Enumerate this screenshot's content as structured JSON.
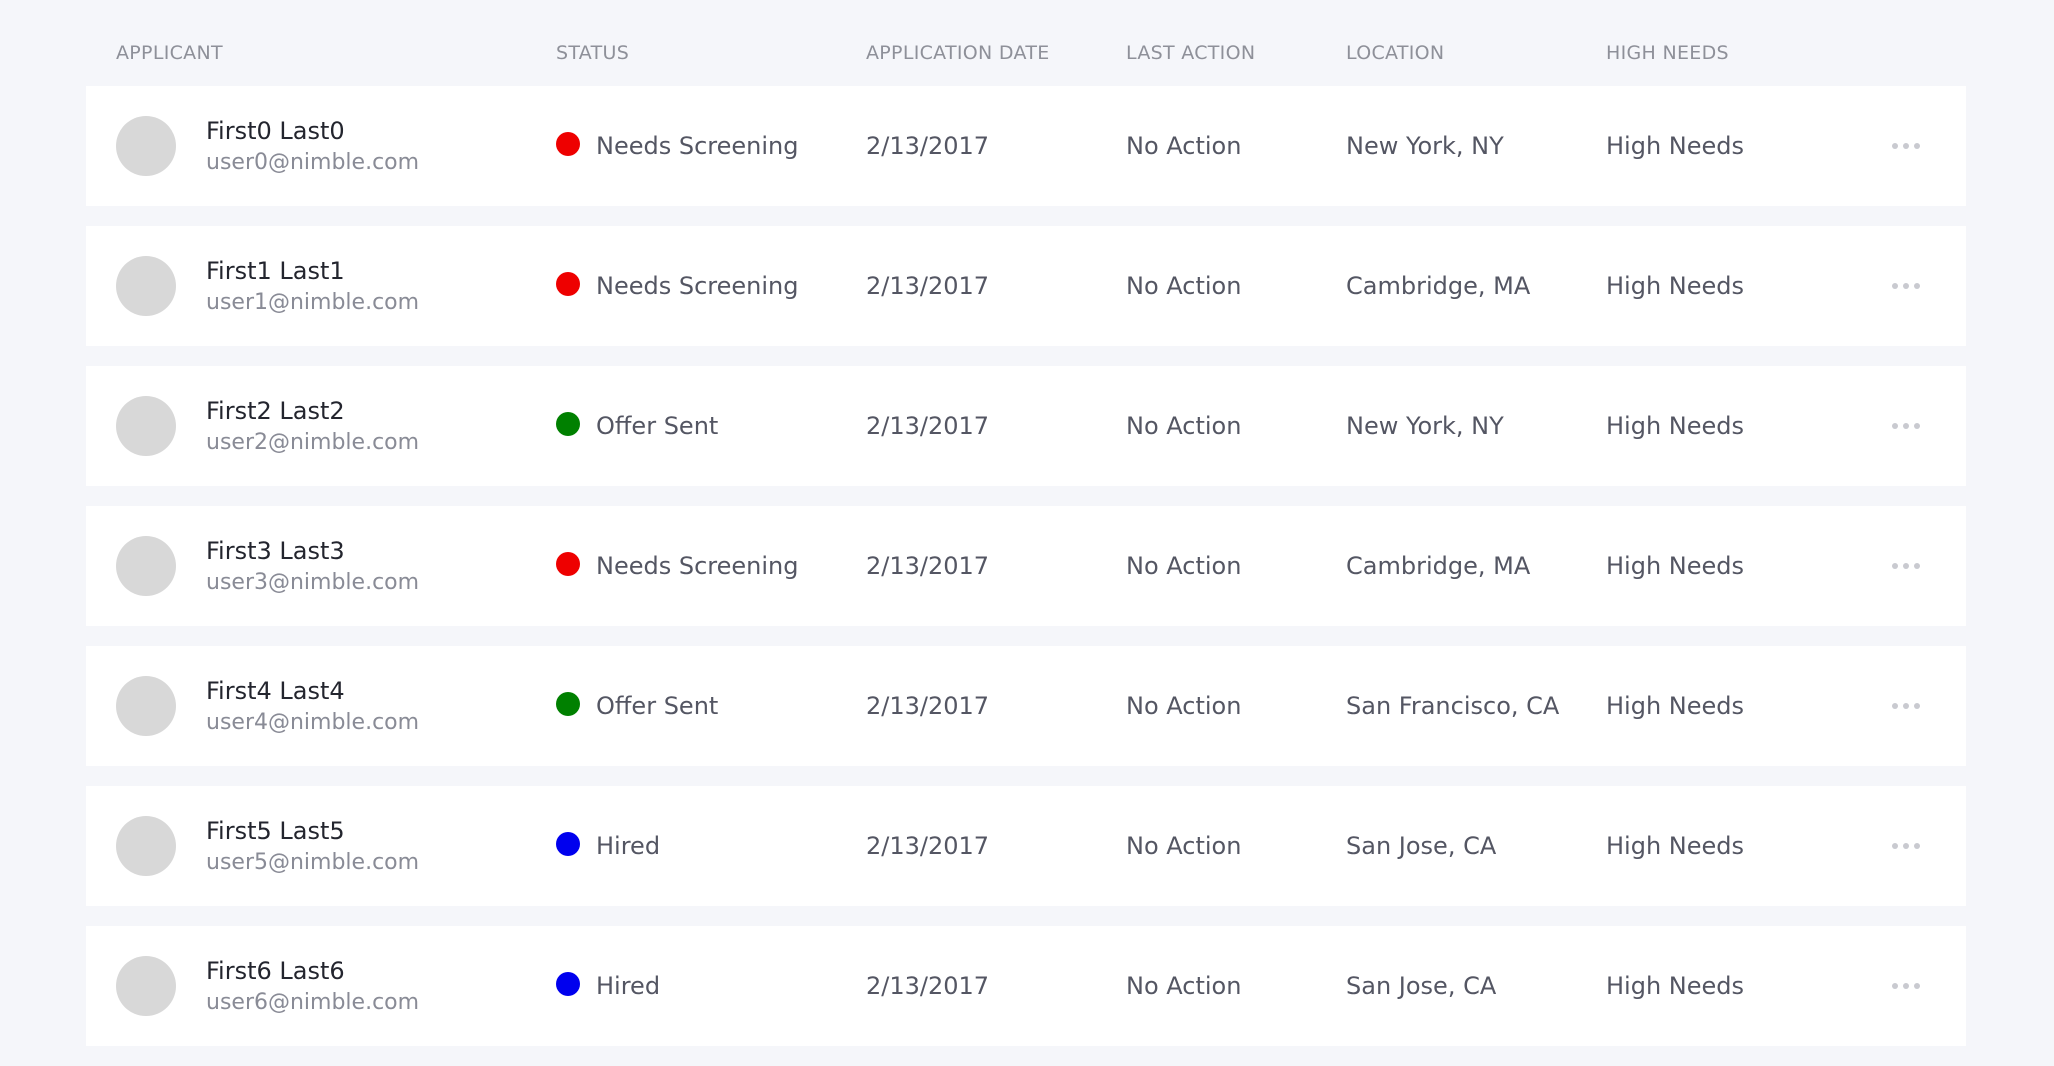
{
  "columns": {
    "applicant": "APPLICANT",
    "status": "STATUS",
    "application_date": "APPLICATION DATE",
    "last_action": "LAST ACTION",
    "location": "LOCATION",
    "high_needs": "HIGH NEEDS"
  },
  "status_colors": {
    "Needs Screening": "#ee0000",
    "Offer Sent": "#008000",
    "Hired": "#0000ee"
  },
  "more_icon": "more-horizontal-icon",
  "applicants": [
    {
      "name": "First0 Last0",
      "email": "user0@nimble.com",
      "status": "Needs Screening",
      "date": "2/13/2017",
      "last_action": "No Action",
      "location": "New York, NY",
      "high_needs": "High Needs"
    },
    {
      "name": "First1 Last1",
      "email": "user1@nimble.com",
      "status": "Needs Screening",
      "date": "2/13/2017",
      "last_action": "No Action",
      "location": "Cambridge, MA",
      "high_needs": "High Needs"
    },
    {
      "name": "First2 Last2",
      "email": "user2@nimble.com",
      "status": "Offer Sent",
      "date": "2/13/2017",
      "last_action": "No Action",
      "location": "New York, NY",
      "high_needs": "High Needs"
    },
    {
      "name": "First3 Last3",
      "email": "user3@nimble.com",
      "status": "Needs Screening",
      "date": "2/13/2017",
      "last_action": "No Action",
      "location": "Cambridge, MA",
      "high_needs": "High Needs"
    },
    {
      "name": "First4 Last4",
      "email": "user4@nimble.com",
      "status": "Offer Sent",
      "date": "2/13/2017",
      "last_action": "No Action",
      "location": "San Francisco, CA",
      "high_needs": "High Needs"
    },
    {
      "name": "First5 Last5",
      "email": "user5@nimble.com",
      "status": "Hired",
      "date": "2/13/2017",
      "last_action": "No Action",
      "location": "San Jose, CA",
      "high_needs": "High Needs"
    },
    {
      "name": "First6 Last6",
      "email": "user6@nimble.com",
      "status": "Hired",
      "date": "2/13/2017",
      "last_action": "No Action",
      "location": "San Jose, CA",
      "high_needs": "High Needs"
    }
  ]
}
